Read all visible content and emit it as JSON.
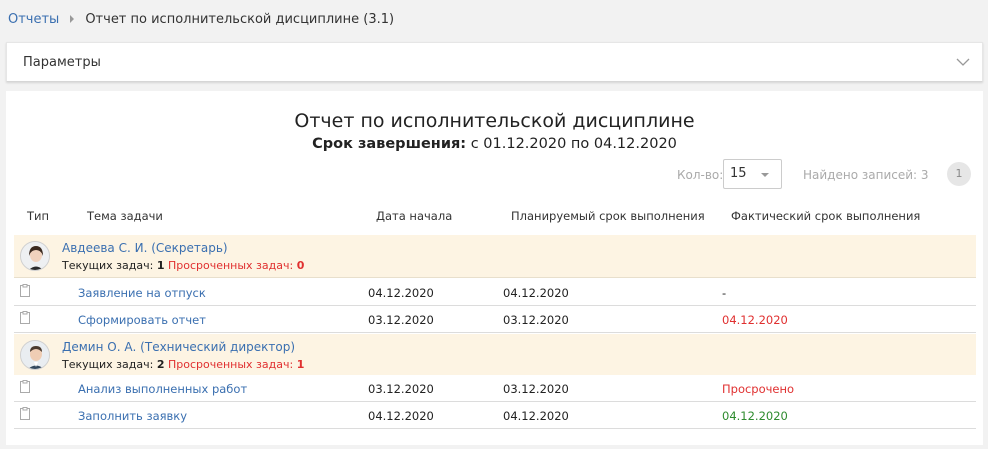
{
  "breadcrumb": {
    "root": "Отчеты",
    "current": "Отчет по исполнительской дисциплине (3.1)"
  },
  "params": {
    "label": "Параметры"
  },
  "report": {
    "title": "Отчет по исполнительской дисциплине",
    "subtitle_bold": "Срок завершения:",
    "subtitle_rest": " с 01.12.2020 по 04.12.2020"
  },
  "pager": {
    "count_label": "Кол-во:",
    "count_value": "15",
    "found": "Найдено записей: 3",
    "page": "1"
  },
  "columns": [
    "Тип",
    "Тема задачи",
    "Дата начала",
    "Планируемый срок выполнения",
    "Фактический срок выполнения"
  ],
  "groups": [
    {
      "name": "Авдеева С. И. (Секретарь)",
      "current_label": "Текущих задач:",
      "current": "1",
      "overdue_label": "Просроченных задач:",
      "overdue": "0",
      "tasks": [
        {
          "title": "Заявление на отпуск",
          "start": "04.12.2020",
          "planned": "04.12.2020",
          "actual": "-",
          "actual_color": "#222222"
        },
        {
          "title": "Сформировать отчет",
          "start": "03.12.2020",
          "planned": "03.12.2020",
          "actual": "04.12.2020",
          "actual_color": "#e03030"
        }
      ]
    },
    {
      "name": "Демин О. А. (Технический директор)",
      "current_label": "Текущих задач:",
      "current": "2",
      "overdue_label": "Просроченных задач:",
      "overdue": "1",
      "tasks": [
        {
          "title": "Анализ выполненных работ",
          "start": "03.12.2020",
          "planned": "03.12.2020",
          "actual": "Просрочено",
          "actual_color": "#e03030"
        },
        {
          "title": "Заполнить заявку",
          "start": "04.12.2020",
          "planned": "04.12.2020",
          "actual": "04.12.2020",
          "actual_color": "#2e8b2e"
        }
      ]
    }
  ],
  "icons": {
    "task_type": "clipboard-icon",
    "params_toggle": "chevron-down-icon",
    "breadcrumb_sep": "chevron-right-icon"
  },
  "colors": {
    "link": "#3a6fb0",
    "overdue": "#e03030",
    "ontime": "#2e8b2e",
    "group_bg": "#fdf4e3"
  }
}
